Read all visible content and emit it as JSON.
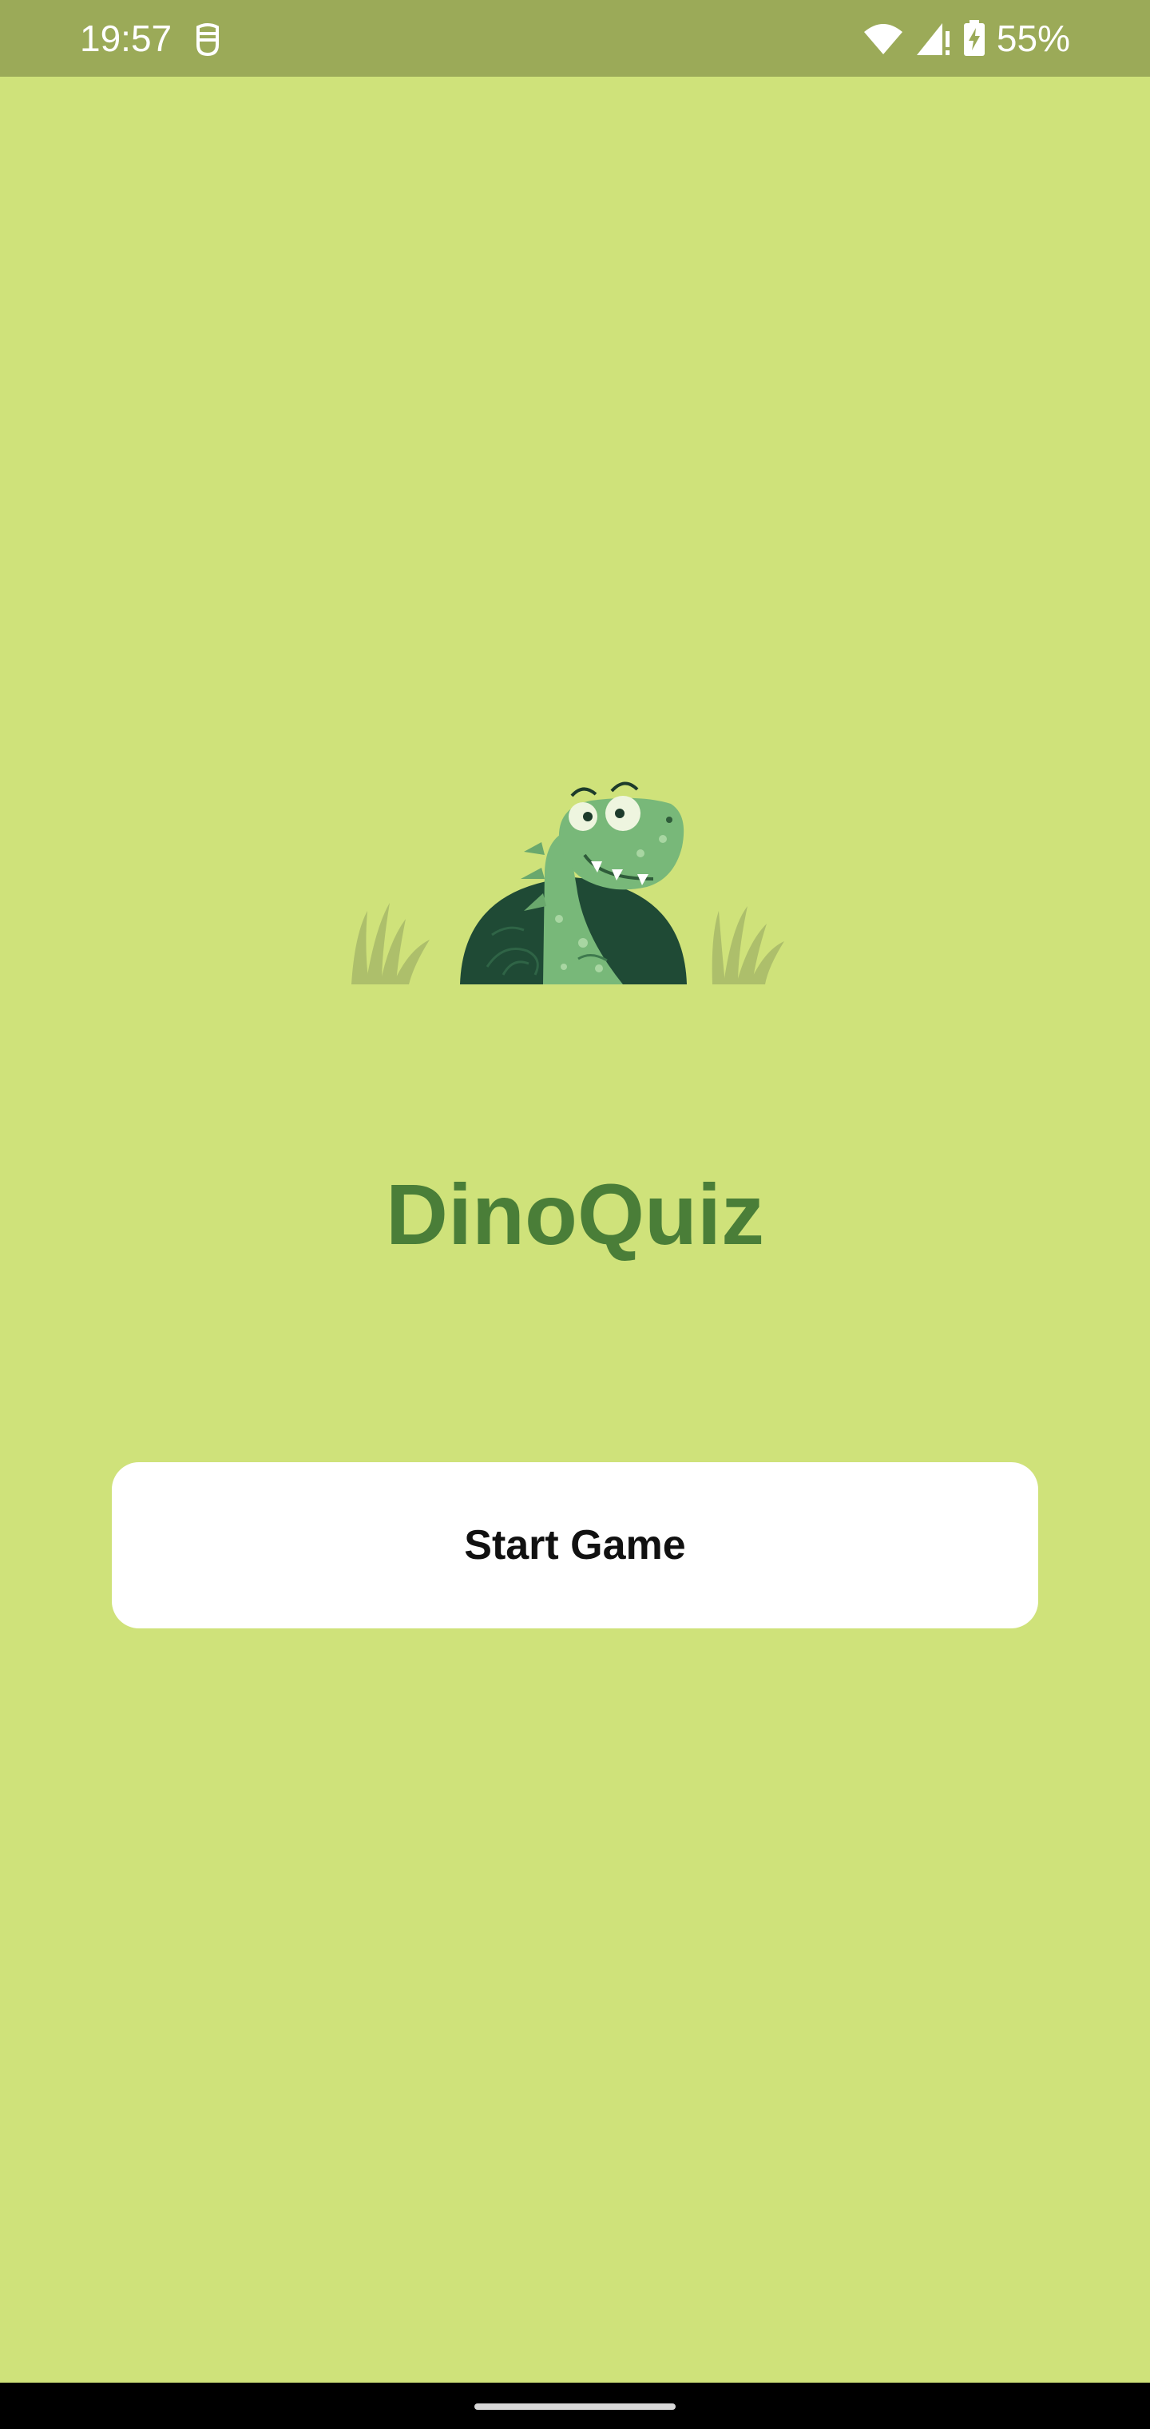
{
  "status_bar": {
    "time": "19:57",
    "battery": "55%",
    "icons": [
      "app-notification-icon",
      "wifi-icon",
      "cell-signal-icon",
      "battery-charging-icon"
    ]
  },
  "main": {
    "title": "DinoQuiz",
    "start_button_label": "Start Game",
    "illustration": "dinosaur-icon"
  },
  "colors": {
    "background": "#cfe27a",
    "status_bar": "#9baa58",
    "title": "#4a7e38",
    "button": "#ffffff"
  }
}
